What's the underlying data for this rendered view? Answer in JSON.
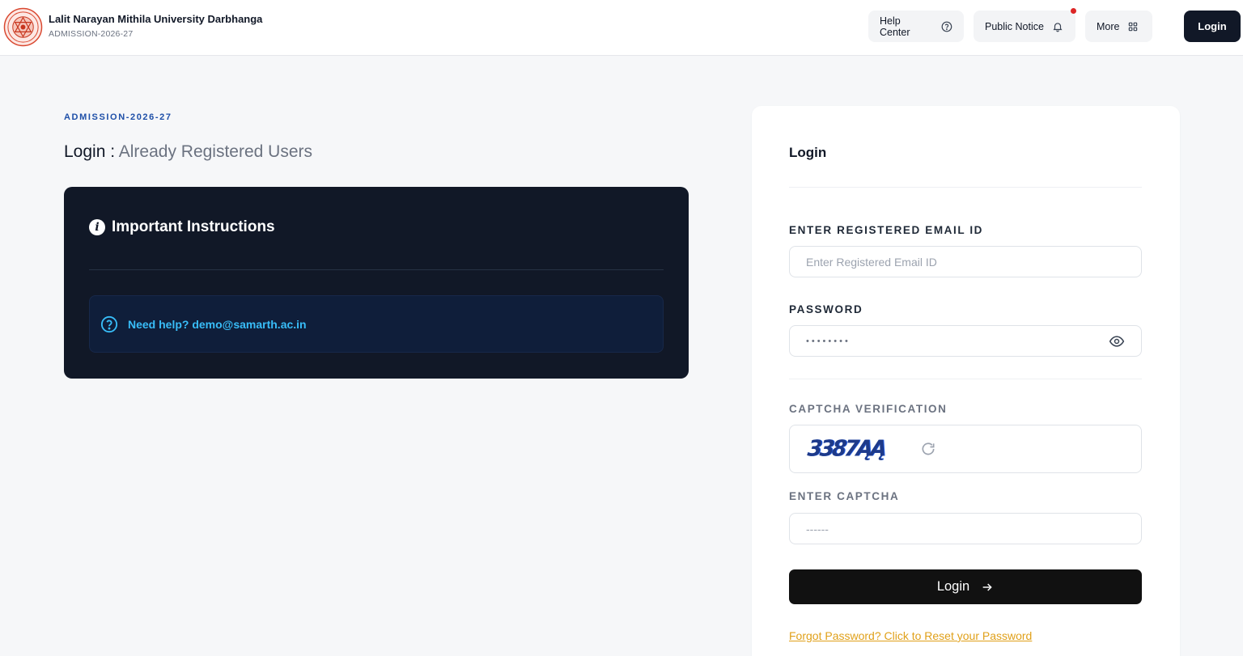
{
  "header": {
    "university_name": "Lalit Narayan Mithila University Darbhanga",
    "session": "ADMISSION-2026-27",
    "nav": {
      "help_center": "Help Center",
      "public_notice": "Public Notice",
      "more": "More",
      "login": "Login"
    },
    "icons": {
      "help": "question-circle-icon",
      "notice": "bell-icon",
      "more": "grid-icon"
    }
  },
  "left": {
    "eyebrow": "ADMISSION-2026-27",
    "title_main": "Login :",
    "title_sub": "Already Registered Users",
    "instructions": {
      "heading": "Important Instructions",
      "help_text": "Need help? demo@samarth.ac.in"
    }
  },
  "login_panel": {
    "title": "Login",
    "email_label": "ENTER REGISTERED EMAIL ID",
    "email_placeholder": "Enter Registered Email ID",
    "email_value": "",
    "password_label": "PASSWORD",
    "password_mask": "••••••••",
    "captcha_label": "CAPTCHA VERIFICATION",
    "captcha_text": "3387ĄĄ",
    "enter_captcha_label": "ENTER CAPTCHA",
    "captcha_placeholder": "------",
    "submit_label": "Login",
    "forgot_link": "Forgot Password? Click to Reset your Password"
  },
  "colors": {
    "accent_dark": "#111827",
    "eyebrow_blue": "#1e4fa8",
    "help_cyan": "#38bdf8",
    "link_amber": "#e0a019",
    "notification_red": "#dc2626"
  }
}
